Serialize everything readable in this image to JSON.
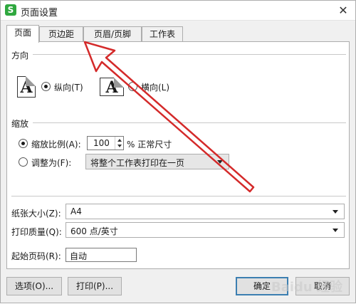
{
  "window": {
    "title": "页面设置",
    "app_icon_letter": "S",
    "close_symbol": "✕"
  },
  "tabs": [
    {
      "label": "页面",
      "active": true
    },
    {
      "label": "页边距",
      "active": false
    },
    {
      "label": "页眉/页脚",
      "active": false
    },
    {
      "label": "工作表",
      "active": false
    }
  ],
  "orientation": {
    "group_label": "方向",
    "portrait_label": "纵向(T)",
    "landscape_label": "横向(L)",
    "icon_letter": "A",
    "selected": "portrait"
  },
  "scaling": {
    "group_label": "缩放",
    "scale_label": "缩放比例(A):",
    "scale_value": "100",
    "scale_suffix": "% 正常尺寸",
    "fit_label": "调整为(F):",
    "fit_option": "将整个工作表打印在一页",
    "selected": "scale"
  },
  "paper": {
    "size_label": "纸张大小(Z):",
    "size_value": "A4",
    "quality_label": "打印质量(Q):",
    "quality_value": "600 点/英寸",
    "start_page_label": "起始页码(R):",
    "start_page_value": "自动"
  },
  "buttons": {
    "options": "选项(O)...",
    "print": "打印(P)...",
    "ok": "确定",
    "cancel": "取消"
  },
  "watermark": "Baidu 经验",
  "colors": {
    "annotation_arrow": "#d42a2a",
    "app_icon": "#2fa83f",
    "default_button_border": "#3c7fb1"
  }
}
